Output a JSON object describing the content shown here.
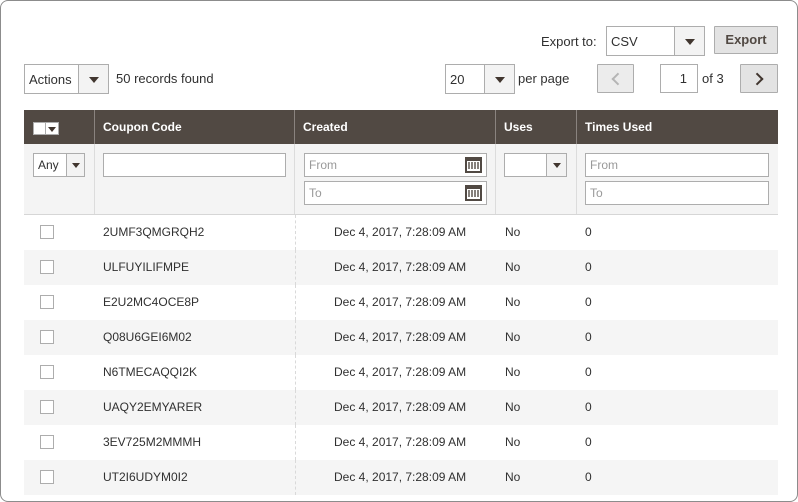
{
  "toolbar": {
    "export_label": "Export to:",
    "export_format": "CSV",
    "export_button": "Export",
    "actions_label": "Actions",
    "records_found": "50 records found",
    "page_size": "20",
    "per_page": "per page",
    "current_page": "1",
    "page_count": "of 3"
  },
  "grid": {
    "columns": [
      "Coupon Code",
      "Created",
      "Uses",
      "Times Used"
    ],
    "filters": {
      "select_any": "Any",
      "created_from": "From",
      "created_to": "To",
      "times_from": "From",
      "times_to": "To"
    },
    "rows": [
      {
        "code": "2UMF3QMGRQH2",
        "created": "Dec 4, 2017, 7:28:09 AM",
        "uses": "No",
        "times": "0"
      },
      {
        "code": "ULFUYILIFMPE",
        "created": "Dec 4, 2017, 7:28:09 AM",
        "uses": "No",
        "times": "0"
      },
      {
        "code": "E2U2MC4OCE8P",
        "created": "Dec 4, 2017, 7:28:09 AM",
        "uses": "No",
        "times": "0"
      },
      {
        "code": "Q08U6GEI6M02",
        "created": "Dec 4, 2017, 7:28:09 AM",
        "uses": "No",
        "times": "0"
      },
      {
        "code": "N6TMECAQQI2K",
        "created": "Dec 4, 2017, 7:28:09 AM",
        "uses": "No",
        "times": "0"
      },
      {
        "code": "UAQY2EMYARER",
        "created": "Dec 4, 2017, 7:28:09 AM",
        "uses": "No",
        "times": "0"
      },
      {
        "code": "3EV725M2MMMH",
        "created": "Dec 4, 2017, 7:28:09 AM",
        "uses": "No",
        "times": "0"
      },
      {
        "code": "UT2I6UDYM0I2",
        "created": "Dec 4, 2017, 7:28:09 AM",
        "uses": "No",
        "times": "0"
      }
    ]
  },
  "colors": {
    "header_bg": "#514943",
    "row_alt": "#f5f5f5",
    "border": "#adadad"
  }
}
